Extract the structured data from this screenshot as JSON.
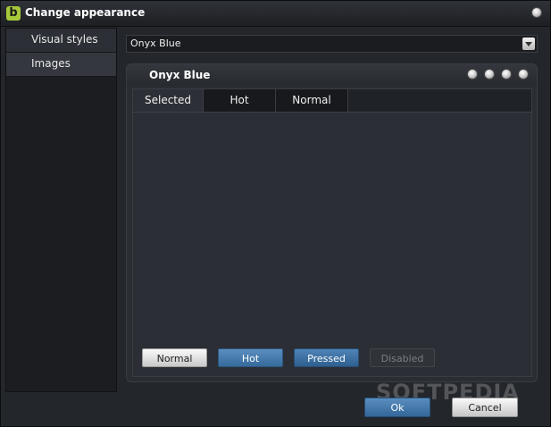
{
  "window": {
    "title": "Change appearance",
    "app_icon_letter": "b"
  },
  "sidebar": {
    "items": [
      {
        "label": "Visual styles"
      },
      {
        "label": "Images"
      }
    ]
  },
  "style_select": {
    "value": "Onyx Blue"
  },
  "preview": {
    "title": "Onyx Blue",
    "tabs": [
      {
        "label": "Selected"
      },
      {
        "label": "Hot"
      },
      {
        "label": "Normal"
      }
    ],
    "buttons": [
      {
        "label": "Normal"
      },
      {
        "label": "Hot"
      },
      {
        "label": "Pressed"
      },
      {
        "label": "Disabled"
      }
    ]
  },
  "footer": {
    "ok_label": "Ok",
    "cancel_label": "Cancel",
    "watermark": "SOFTPEDIA"
  },
  "colors": {
    "accent": "#4a7eb0",
    "app_icon": "#a6c93a",
    "background": "#23262b"
  }
}
